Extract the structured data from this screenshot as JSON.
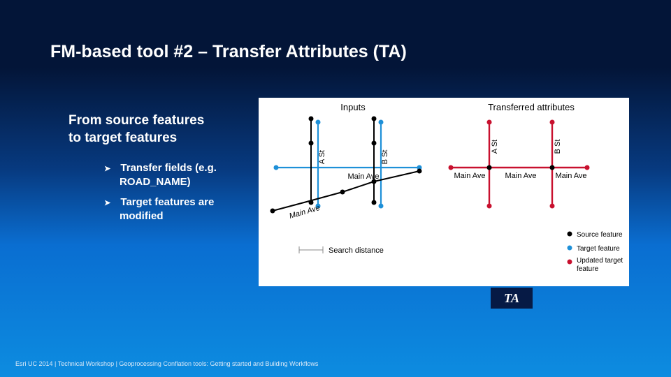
{
  "title": "FM-based tool #2 – Transfer Attributes (TA)",
  "subtitle_l1": "From source features",
  "subtitle_l2": "to target features",
  "bullet1_l1": "Transfer fields (e.g.",
  "bullet1_l2": "ROAD_NAME)",
  "bullet2_l1": "Target features are",
  "bullet2_l2": "modified",
  "badge": "TA",
  "footer": "Esri UC 2014 | Technical Workshop |   Geoprocessing Conflation tools: Getting started and Building Workflows",
  "fig": {
    "hdr_inputs": "Inputs",
    "hdr_transferred": "Transferred attributes",
    "a_st": "A St",
    "b_st": "B St",
    "main_ave": "Main Ave",
    "search_distance": "Search distance",
    "legend_source": "Source feature",
    "legend_target": "Target feature",
    "legend_updated_l1": "Updated target",
    "legend_updated_l2": "feature"
  }
}
